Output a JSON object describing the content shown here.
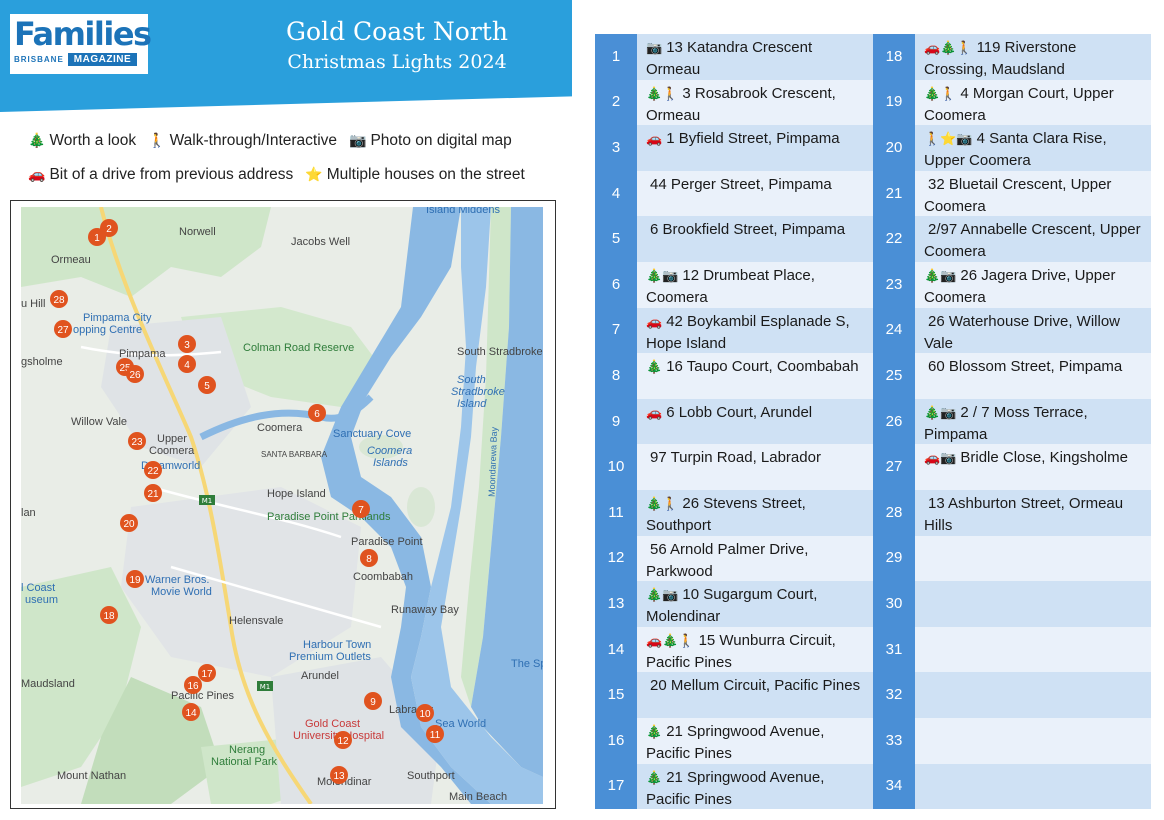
{
  "header": {
    "logo_main": "Families",
    "logo_sub_city": "BRISBANE",
    "logo_sub_mag": "MAGAZINE",
    "title_line1": "Gold Coast North",
    "title_line2": "Christmas Lights 2024",
    "banner_color": "#2a9fdc"
  },
  "legend": [
    {
      "icon": "tree-icon",
      "glyph": "🎄",
      "label": "Worth a look"
    },
    {
      "icon": "walking-person-icon",
      "glyph": "🚶",
      "label": "Walk-through/Interactive"
    },
    {
      "icon": "camera-icon",
      "glyph": "📷",
      "label": "Photo on digital map"
    },
    {
      "icon": "car-icon",
      "glyph": "🚗",
      "label": "Bit of a drive from previous address"
    },
    {
      "icon": "star-icon",
      "glyph": "⭐",
      "label": "Multiple houses on the street"
    }
  ],
  "map": {
    "places": {
      "island_middens": "Island Middens",
      "norwell": "Norwell",
      "jacobs_well": "Jacobs Well",
      "ormeau": "Ormeau",
      "hills": "u Hill",
      "pimpama_city": "Pimpama City",
      "shopping_centre": "opping Centre",
      "gsholme": "gsholme",
      "pimpama": "Pimpama",
      "colman_road_reserve": "Colman Road Reserve",
      "south_stradbroke": "South Stradbroke",
      "south_stradbroke_island_1": "South",
      "south_stradbroke_island_2": "Stradbroke",
      "south_stradbroke_island_3": "Island",
      "willow_vale": "Willow Vale",
      "coomera": "Coomera",
      "sanctuary_cove": "Sanctuary Cove",
      "upper_coomera_1": "Upper",
      "upper_coomera_2": "Coomera",
      "dreamworld": "Dreamworld",
      "santa_barbara": "SANTA BARBARA",
      "coomera_islands_1": "Coomera",
      "coomera_islands_2": "Islands",
      "moondarewa_bay": "Moondarewa Bay",
      "m1": "M1",
      "hope_island": "Hope Island",
      "paradise_point_parklands": "Paradise Point Parklands",
      "lan": "lan",
      "paradise_point": "Paradise Point",
      "coombabah": "Coombabah",
      "gold_coast_museum_1": "l Coast",
      "gold_coast_museum_2": "useum",
      "warner_bros": "Warner Bros.",
      "movie_world": "Movie World",
      "runaway_bay": "Runaway Bay",
      "helensvale": "Helensvale",
      "harbour_town_1": "Harbour Town",
      "harbour_town_2": "Premium Outlets",
      "the_spit": "The Sp",
      "maudsland": "Maudsland",
      "pacific_pines": "Pacific Pines",
      "arundel": "Arundel",
      "m1_south": "M1",
      "labrador": "Labrador",
      "sea_world": "Sea World",
      "gold_coast_uni_1": "Gold Coast",
      "gold_coast_uni_2": "University Hospital",
      "nerang_np_1": "Nerang",
      "nerang_np_2": "National Park",
      "mount_nathan": "Mount Nathan",
      "molendinar": "Molendinar",
      "southport": "Southport",
      "main_beach": "Main Beach"
    },
    "pins": [
      "1",
      "2",
      "3",
      "4",
      "5",
      "6",
      "7",
      "8",
      "9",
      "10",
      "11",
      "12",
      "13",
      "14",
      "16",
      "17",
      "18",
      "19",
      "20",
      "21",
      "22",
      "23",
      "25",
      "26",
      "27",
      "28"
    ],
    "pin_color": "#e0531f",
    "water_color": "#8ab8e3",
    "land_color": "#e8ece6",
    "park_color": "#c8e2c4"
  },
  "table": {
    "header_color": "#4a8fd6",
    "left": [
      {
        "n": "1",
        "icons": "📷",
        "text": "13 Katandra Crescent Ormeau"
      },
      {
        "n": "2",
        "icons": "🎄🚶",
        "text": "3 Rosabrook Crescent, Ormeau"
      },
      {
        "n": "3",
        "icons": "🚗",
        "text": "1 Byfield Street, Pimpama"
      },
      {
        "n": "4",
        "icons": "",
        "text": "44 Perger Street, Pimpama"
      },
      {
        "n": "5",
        "icons": "",
        "text": "6 Brookfield Street, Pimpama"
      },
      {
        "n": "6",
        "icons": "🎄📷",
        "text": "12 Drumbeat Place, Coomera"
      },
      {
        "n": "7",
        "icons": "🚗",
        "text": "42 Boykambil Esplanade S, Hope Island"
      },
      {
        "n": "8",
        "icons": "🎄",
        "text": "16 Taupo Court, Coombabah"
      },
      {
        "n": "9",
        "icons": "🚗",
        "text": "6 Lobb Court, Arundel"
      },
      {
        "n": "10",
        "icons": "",
        "text": "97 Turpin Road, Labrador"
      },
      {
        "n": "11",
        "icons": "🎄🚶",
        "text": "26 Stevens Street, Southport"
      },
      {
        "n": "12",
        "icons": "",
        "text": "56 Arnold Palmer Drive, Parkwood"
      },
      {
        "n": "13",
        "icons": "🎄📷",
        "text": "10 Sugargum Court, Molendinar"
      },
      {
        "n": "14",
        "icons": "🚗🎄🚶",
        "text": "15 Wunburra Circuit, Pacific Pines"
      },
      {
        "n": "15",
        "icons": "",
        "text": "20 Mellum Circuit, Pacific Pines"
      },
      {
        "n": "16",
        "icons": "🎄",
        "text": "21 Springwood Avenue, Pacific Pines"
      },
      {
        "n": "17",
        "icons": "🎄",
        "text": "21 Springwood Avenue, Pacific Pines"
      }
    ],
    "right": [
      {
        "n": "18",
        "icons": "🚗🎄🚶",
        "text": "119 Riverstone Crossing, Maudsland"
      },
      {
        "n": "19",
        "icons": "🎄🚶",
        "text": "4 Morgan Court, Upper Coomera"
      },
      {
        "n": "20",
        "icons": "🚶⭐📷",
        "text": "4 Santa Clara Rise, Upper Coomera"
      },
      {
        "n": "21",
        "icons": "",
        "text": "32 Bluetail Crescent, Upper Coomera"
      },
      {
        "n": "22",
        "icons": "",
        "text": "2/97 Annabelle Crescent, Upper Coomera"
      },
      {
        "n": "23",
        "icons": "🎄📷",
        "text": "26 Jagera Drive, Upper Coomera"
      },
      {
        "n": "24",
        "icons": "",
        "text": "26 Waterhouse Drive, Willow Vale"
      },
      {
        "n": "25",
        "icons": "",
        "text": "60 Blossom Street, Pimpama"
      },
      {
        "n": "26",
        "icons": "🎄📷",
        "text": "2 / 7 Moss Terrace, Pimpama"
      },
      {
        "n": "27",
        "icons": "🚗📷",
        "text": "Bridle Close, Kingsholme"
      },
      {
        "n": "28",
        "icons": "",
        "text": "13 Ashburton Street, Ormeau Hills"
      },
      {
        "n": "29",
        "icons": "",
        "text": ""
      },
      {
        "n": "30",
        "icons": "",
        "text": ""
      },
      {
        "n": "31",
        "icons": "",
        "text": ""
      },
      {
        "n": "32",
        "icons": "",
        "text": ""
      },
      {
        "n": "33",
        "icons": "",
        "text": ""
      },
      {
        "n": "34",
        "icons": "",
        "text": ""
      }
    ]
  }
}
